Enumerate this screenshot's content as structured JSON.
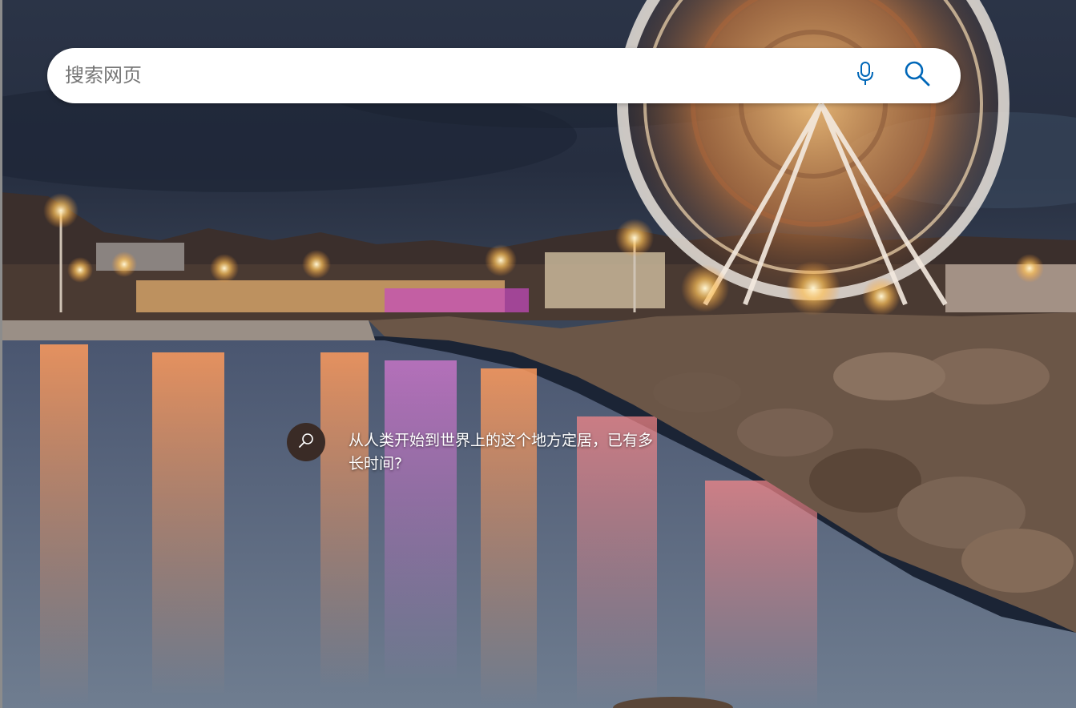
{
  "search": {
    "placeholder": "搜索网页",
    "value": ""
  },
  "icons": {
    "mic": "microphone-icon",
    "search": "search-icon",
    "quiz": "quiz-search-icon"
  },
  "colors": {
    "accent": "#0067b8",
    "search_bg": "#ffffff",
    "quiz_icon_bg": "#3a2b26"
  },
  "quiz": {
    "text": "从人类开始到世界上的这个地方定居，已有多长时间?"
  }
}
